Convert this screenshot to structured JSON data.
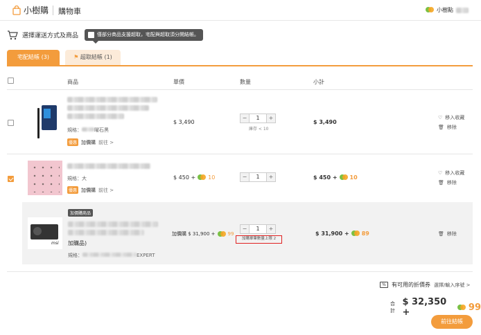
{
  "header": {
    "logo": "小樹購",
    "title": "購物車",
    "user": "小樹點"
  },
  "step": {
    "title": "選擇運送方式及商品",
    "tooltip": "僅部分商品支援超取，宅配與超取須分開結帳。"
  },
  "tabs": [
    {
      "label": "宅配結帳 (3)"
    },
    {
      "label": "超取結帳 (1)"
    }
  ],
  "columns": {
    "product": "商品",
    "unit_price": "單價",
    "quantity": "數量",
    "subtotal": "小計"
  },
  "items": [
    {
      "spec": "規格：",
      "spec_value": "曜石黑",
      "tag": "優惠",
      "addon": "加價購",
      "addon_link": "前往 >",
      "price": "$ 3,490",
      "qty": "1",
      "stock": "庫存 < 10",
      "subtotal": "$ 3,490",
      "fav": "移入收藏",
      "remove": "移除"
    },
    {
      "spec": "規格：大",
      "tag": "優惠",
      "addon": "加價購",
      "addon_link": "前往 >",
      "price": "$ 450 +",
      "points": "10",
      "qty": "1",
      "subtotal": "$ 450 +",
      "sub_points": "10",
      "fav": "移入收藏",
      "remove": "移除"
    },
    {
      "badge": "加價購商品",
      "name_tail": "加購品)",
      "spec": "規格：",
      "spec_tail": "EXPERT",
      "price": "加價購 $ 31,900 +",
      "points": "99",
      "qty": "1",
      "limit": "加購單筆數量上限 2",
      "subtotal": "$ 31,900 +",
      "sub_points": "89",
      "remove": "移除",
      "brand": "msi"
    }
  ],
  "coupon": {
    "label": "有可用的折價券",
    "link": "選擇/輸入序號 >"
  },
  "total": {
    "label": "合計",
    "amount": "$ 32,350 +",
    "points": "99"
  },
  "checkout": "前往結帳",
  "colors": {
    "accent": "#f39c3c",
    "highlight": "#e02020"
  }
}
